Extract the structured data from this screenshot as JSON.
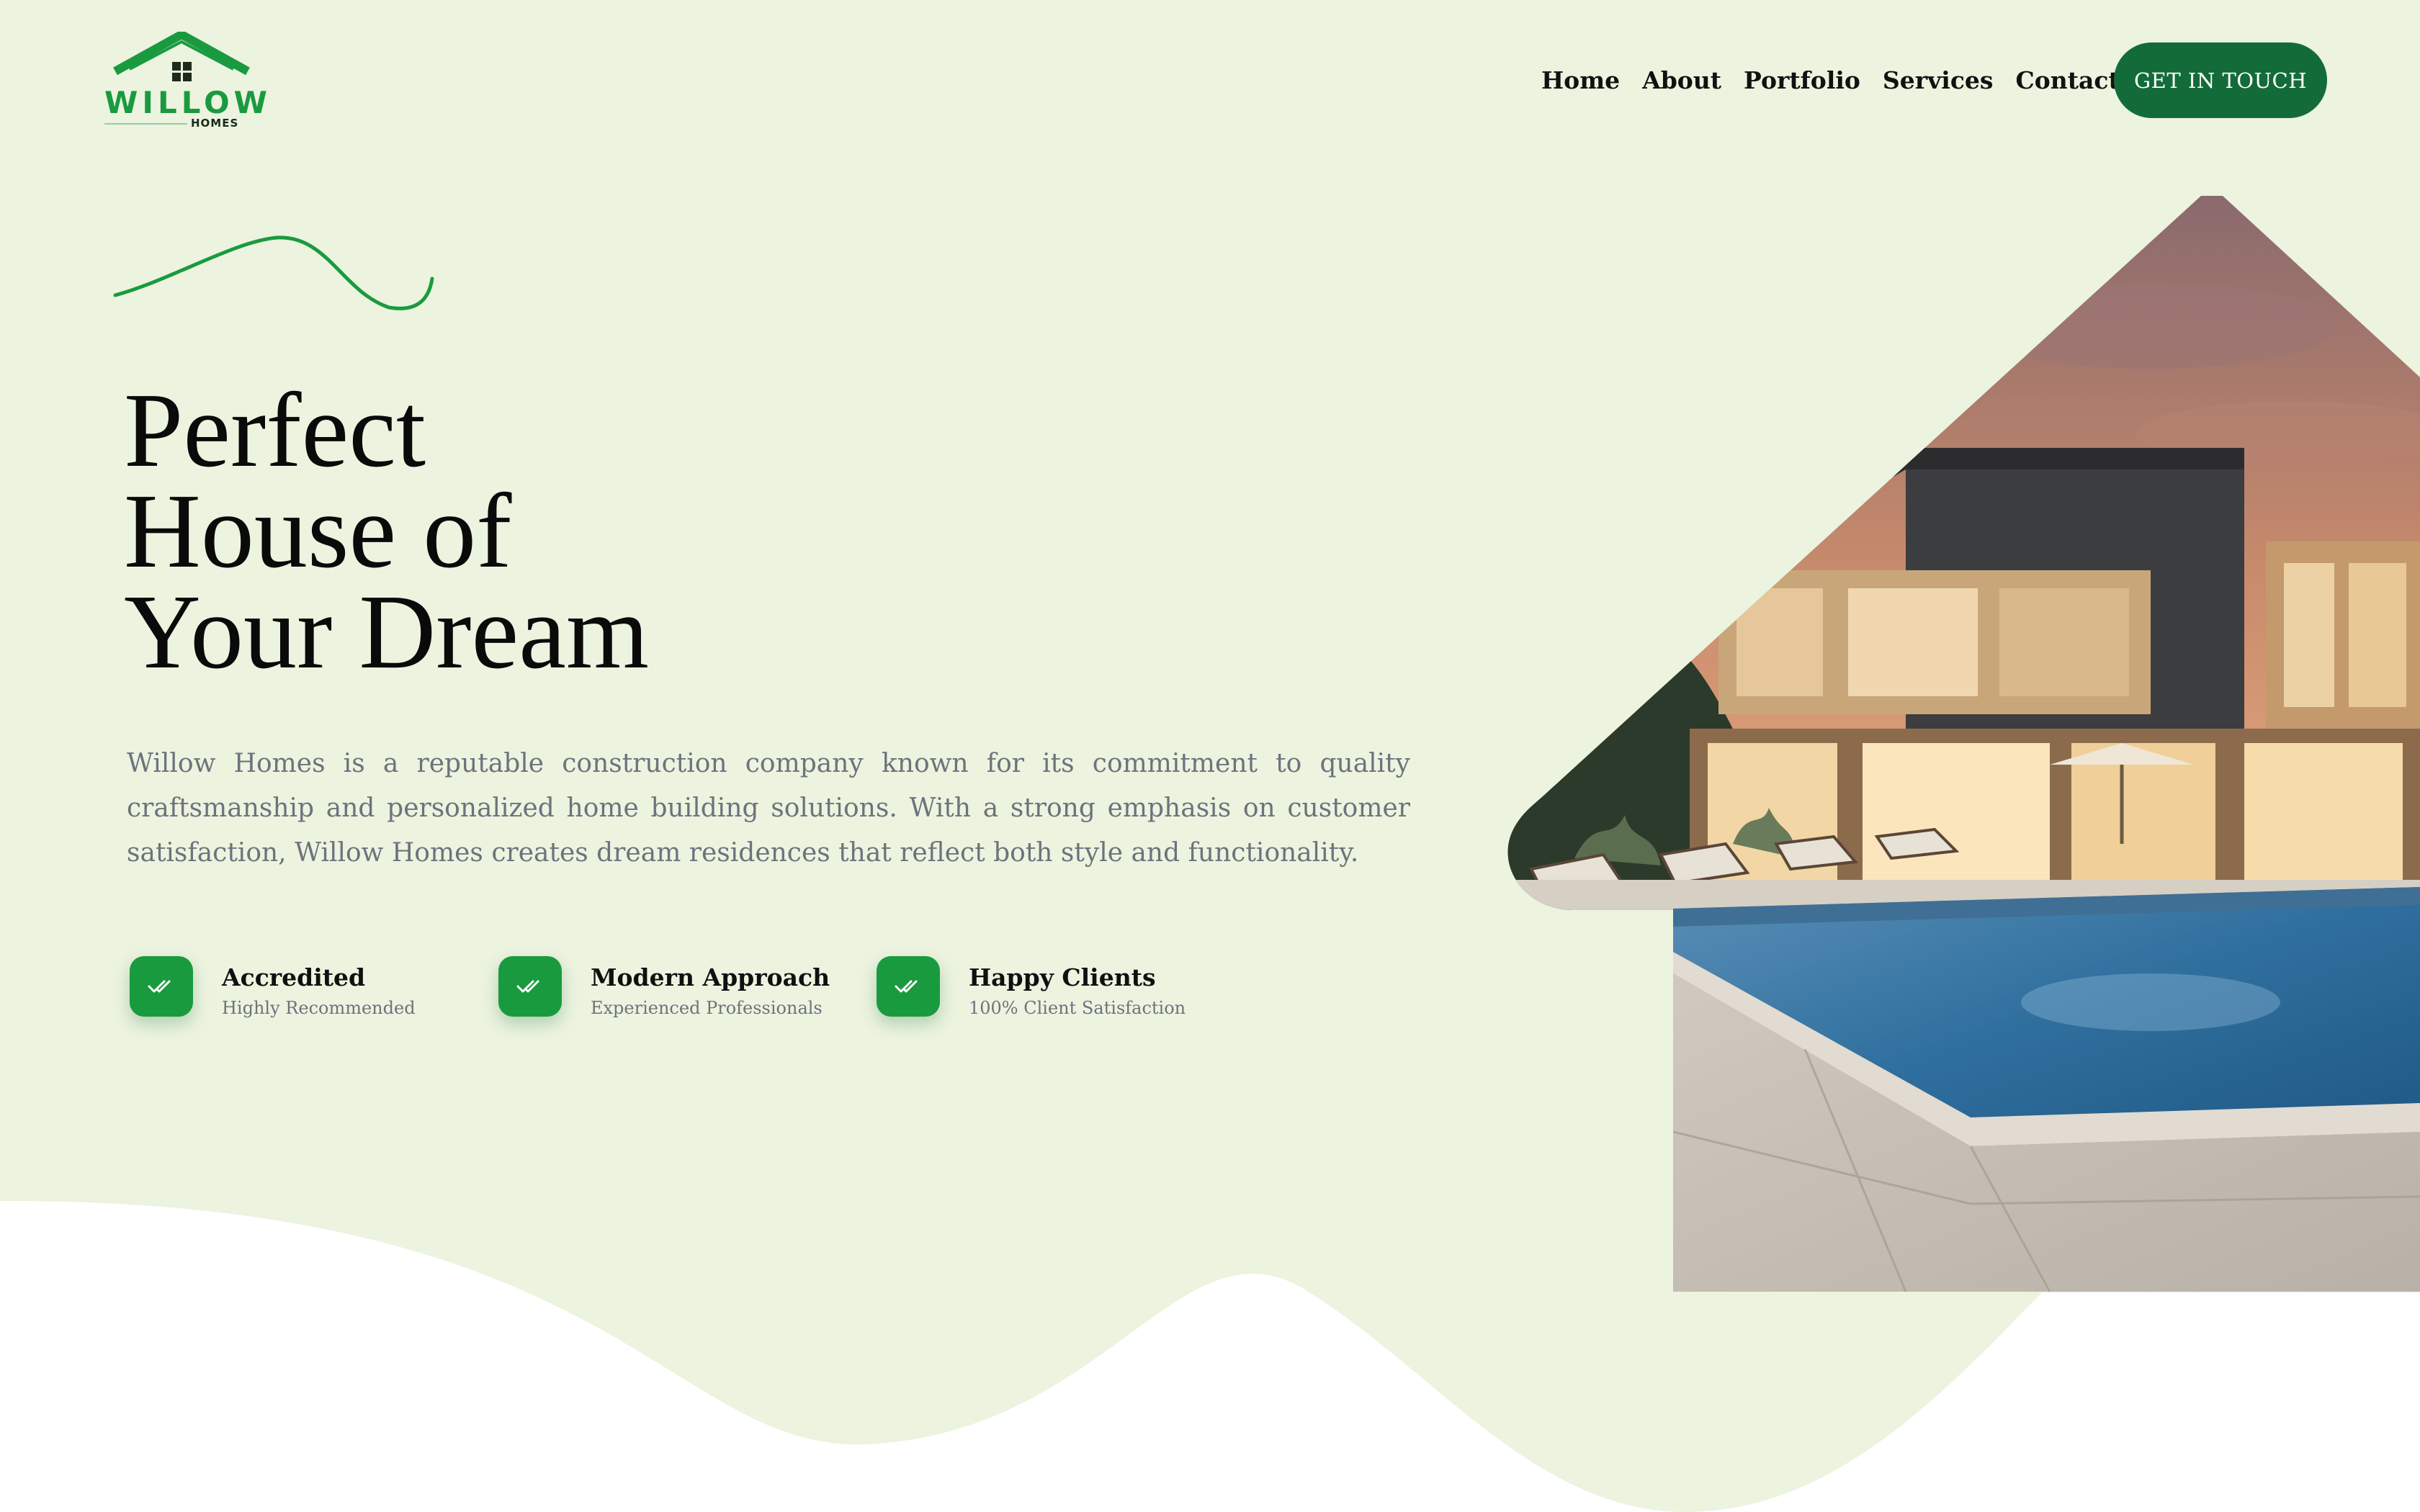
{
  "brand": {
    "name": "WILLOW",
    "sub": "HOMES",
    "colors": {
      "primary": "#1a9a3f",
      "dark_green": "#136b3a",
      "hero_bg": "#ecf3df",
      "muted_text": "#6d737c"
    }
  },
  "nav": {
    "items": [
      {
        "label": "Home"
      },
      {
        "label": "About"
      },
      {
        "label": "Portfolio"
      },
      {
        "label": "Services"
      },
      {
        "label": "Contact"
      }
    ],
    "cta_label": "GET IN TOUCH"
  },
  "hero": {
    "title_lines": [
      "Perfect",
      "House of",
      "Your Dream"
    ],
    "description": "Willow Homes is a reputable construction company known for its commitment to quality craftsmanship and personalized home building solutions. With a strong emphasis on customer satisfaction, Willow Homes creates dream residences that reflect both style and functionality."
  },
  "features": [
    {
      "icon": "double-check-icon",
      "title": "Accredited",
      "subtitle": "Highly Recommended"
    },
    {
      "icon": "double-check-icon",
      "title": "Modern Approach",
      "subtitle": "Experienced Professionals"
    },
    {
      "icon": "double-check-icon",
      "title": "Happy Clients",
      "subtitle": "100% Client Satisfaction"
    }
  ],
  "hero_image": {
    "icon": "modern-house-pool-photo"
  }
}
